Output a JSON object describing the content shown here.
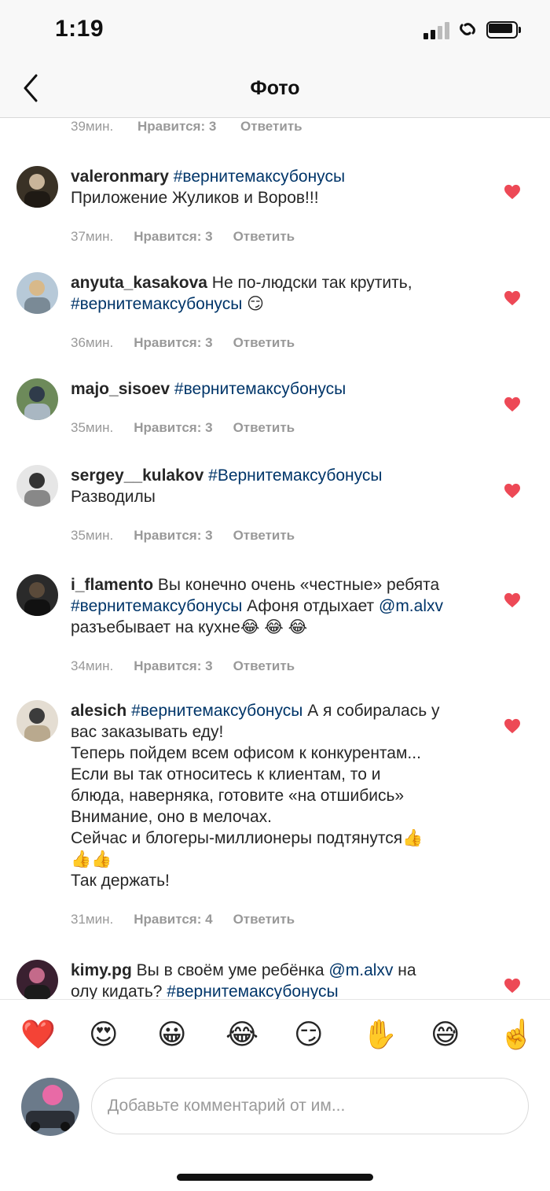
{
  "status_bar": {
    "time": "1:19"
  },
  "nav": {
    "title": "Фото"
  },
  "actions": {
    "like": "Нравится:",
    "reply": "Ответить"
  },
  "top_meta": {
    "time": "39мин.",
    "likes": "Нравится: 3",
    "reply": "Ответить"
  },
  "comments": [
    {
      "username": "valeronmary",
      "lines": [
        [
          {
            "t": "#вернитемаксубонусы",
            "k": "tag"
          }
        ],
        [
          {
            "t": "Приложение Жуликов и Воров!!!"
          }
        ]
      ],
      "time": "37мин.",
      "likes": "Нравится: 3",
      "reply": "Ответить"
    },
    {
      "username": "anyuta_kasakova",
      "lines": [
        [
          {
            "t": "Не по-людски так крутить,"
          }
        ],
        [
          {
            "t": "#вернитемаксубонусы",
            "k": "tag"
          },
          {
            "t": " 😏"
          }
        ]
      ],
      "time": "36мин.",
      "likes": "Нравится: 3",
      "reply": "Ответить"
    },
    {
      "username": "majo_sisoev",
      "lines": [
        [
          {
            "t": "#вернитемаксубонусы",
            "k": "tag"
          }
        ]
      ],
      "time": "35мин.",
      "likes": "Нравится: 3",
      "reply": "Ответить"
    },
    {
      "username": "sergey__kulakov",
      "lines": [
        [
          {
            "t": "#Вернитемаксубонусы",
            "k": "tag"
          }
        ],
        [
          {
            "t": "Разводилы"
          }
        ]
      ],
      "time": "35мин.",
      "likes": "Нравится: 3",
      "reply": "Ответить"
    },
    {
      "username": "i_flamento",
      "lines": [
        [
          {
            "t": "Вы конечно очень «честные» ребята"
          }
        ],
        [
          {
            "t": "#вернитемаксубонусы",
            "k": "tag"
          },
          {
            "t": " Афоня отдыхает "
          },
          {
            "t": "@m.alxv",
            "k": "tag"
          }
        ],
        [
          {
            "t": "разъебывает на кухне😂 😂 😂"
          }
        ]
      ],
      "time": "34мин.",
      "likes": "Нравится: 3",
      "reply": "Ответить"
    },
    {
      "username": "alesich",
      "lines": [
        [
          {
            "t": "#вернитемаксубонусы",
            "k": "tag"
          },
          {
            "t": " А я собиралась у"
          }
        ],
        [
          {
            "t": "вас заказывать еду!"
          }
        ],
        [
          {
            "t": "Теперь пойдем всем офисом к конкурентам..."
          }
        ],
        [
          {
            "t": "Если вы так относитесь к клиентам, то и"
          }
        ],
        [
          {
            "t": "блюда, наверняка, готовите «на отшибись»"
          }
        ],
        [
          {
            "t": "Внимание, оно в мелочах."
          }
        ],
        [
          {
            "t": "Сейчас и блогеры-миллионеры подтянутся👍"
          }
        ],
        [
          {
            "t": "👍👍"
          }
        ],
        [
          {
            "t": "Так держать!"
          }
        ]
      ],
      "time": "31мин.",
      "likes": "Нравится: 4",
      "reply": "Ответить"
    },
    {
      "username": "kimy.pg",
      "lines": [
        [
          {
            "t": "Вы в своём уме ребёнка "
          },
          {
            "t": "@m.alxv",
            "k": "tag"
          },
          {
            "t": " на"
          }
        ],
        [
          {
            "t": "олу кидать? "
          },
          {
            "t": "#вернитемаксубонусы",
            "k": "tag"
          }
        ]
      ],
      "time": "",
      "likes": "",
      "reply": ""
    }
  ],
  "emojis": [
    "❤️",
    "😍",
    "😀",
    "😂",
    "😏",
    "✋",
    "😅",
    "☝️"
  ],
  "composer": {
    "placeholder": "Добавьте комментарий от им..."
  },
  "colors": {
    "like_heart": "#ed4956",
    "hashtag": "#003569",
    "meta": "#999999"
  }
}
